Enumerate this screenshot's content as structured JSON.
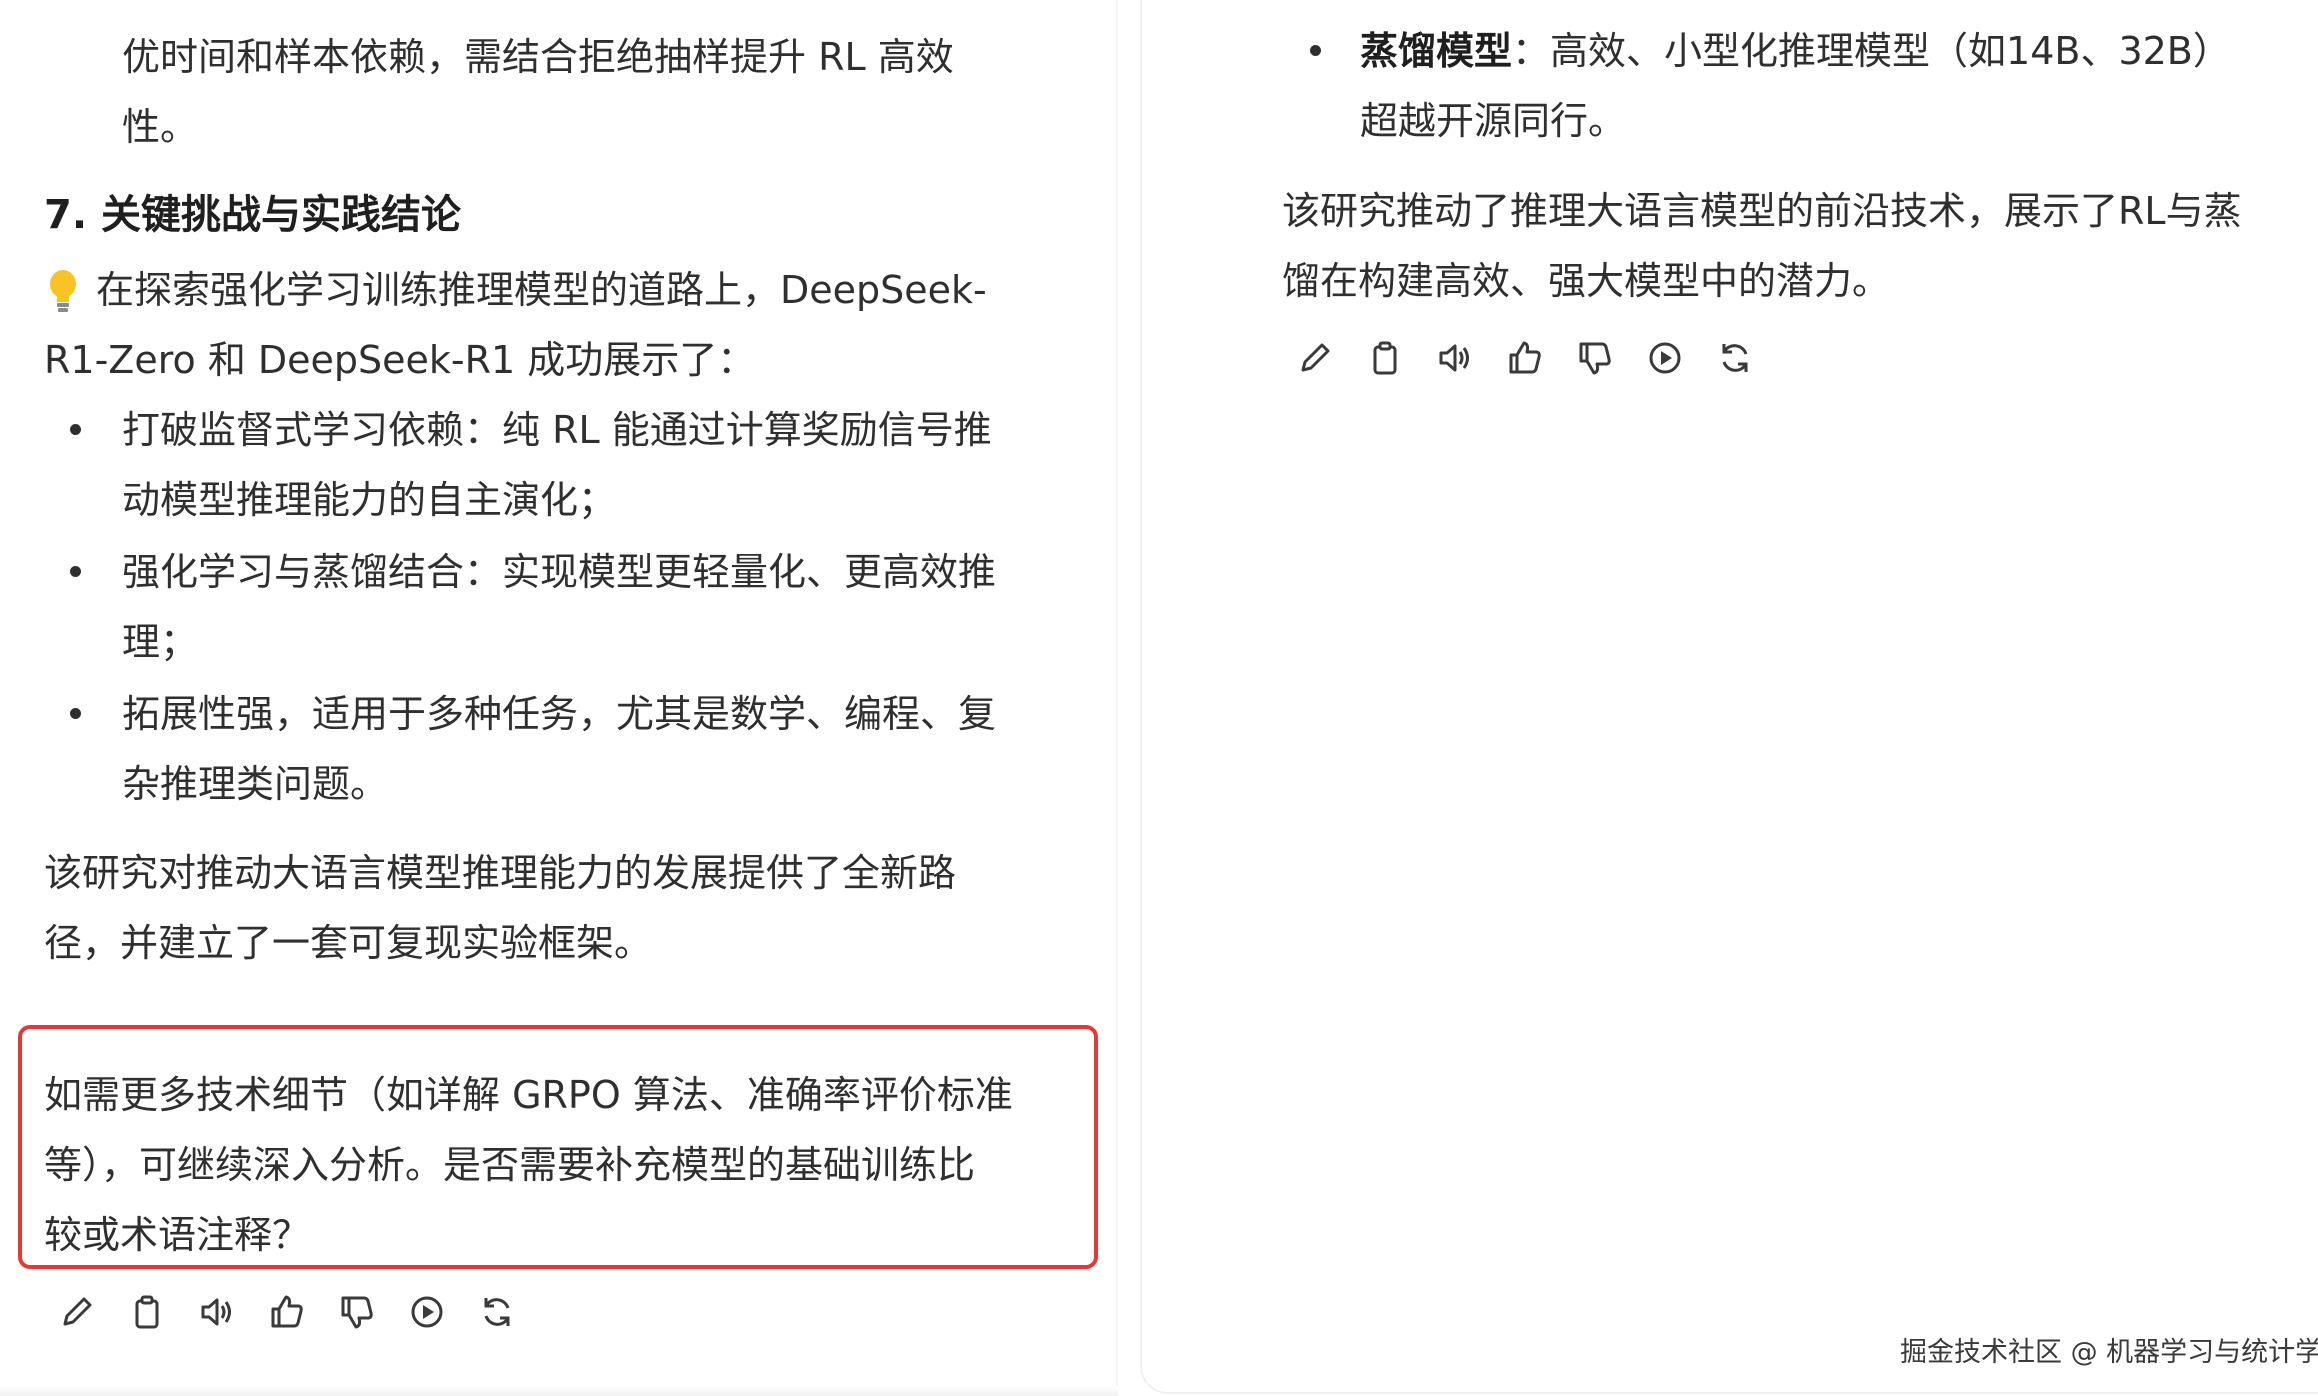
{
  "left": {
    "para_top": [
      "优时间和样本依赖，需结合拒绝抽样提升 RL 高效",
      "性。"
    ],
    "heading": "7. 关键挑战与实践结论",
    "intro_icon": "lightbulb-icon",
    "intro": [
      "在探索强化学习训练推理模型的道路上，DeepSeek-",
      "R1-Zero 和 DeepSeek-R1 成功展示了："
    ],
    "bullets": [
      [
        "打破监督式学习依赖：纯 RL 能通过计算奖励信号推",
        "动模型推理能力的自主演化；"
      ],
      [
        "强化学习与蒸馏结合：实现模型更轻量化、更高效推",
        "理；"
      ],
      [
        "拓展性强，适用于多种任务，尤其是数学、编程、复",
        "杂推理类问题。"
      ]
    ],
    "conclusion": [
      "该研究对推动大语言模型推理能力的发展提供了全新路",
      "径，并建立了一套可复现实验框架。"
    ],
    "highlight": [
      "如需更多技术细节（如详解 GRPO 算法、准确率评价标准",
      "等），可继续深入分析。是否需要补充模型的基础训练比",
      "较或术语注释？"
    ]
  },
  "right": {
    "bullet_bold": "蒸馏模型",
    "bullet_rest": "：高效、小型化推理模型（如14B、32B）",
    "bullet_line2": "超越开源同行。",
    "summary": [
      "该研究推动了推理大语言模型的前沿技术，展示了RL与蒸",
      "馏在构建高效、强大模型中的潜力。"
    ]
  },
  "toolbar_icons": [
    "edit-icon",
    "copy-icon",
    "speaker-icon",
    "thumbs-up-icon",
    "thumbs-down-icon",
    "play-icon",
    "refresh-icon"
  ],
  "watermark": "掘金技术社区 @ 机器学习与统计学",
  "colors": {
    "text": "#2f2f2f",
    "highlight_border": "#e53935",
    "icon": "#3a3a3a"
  }
}
